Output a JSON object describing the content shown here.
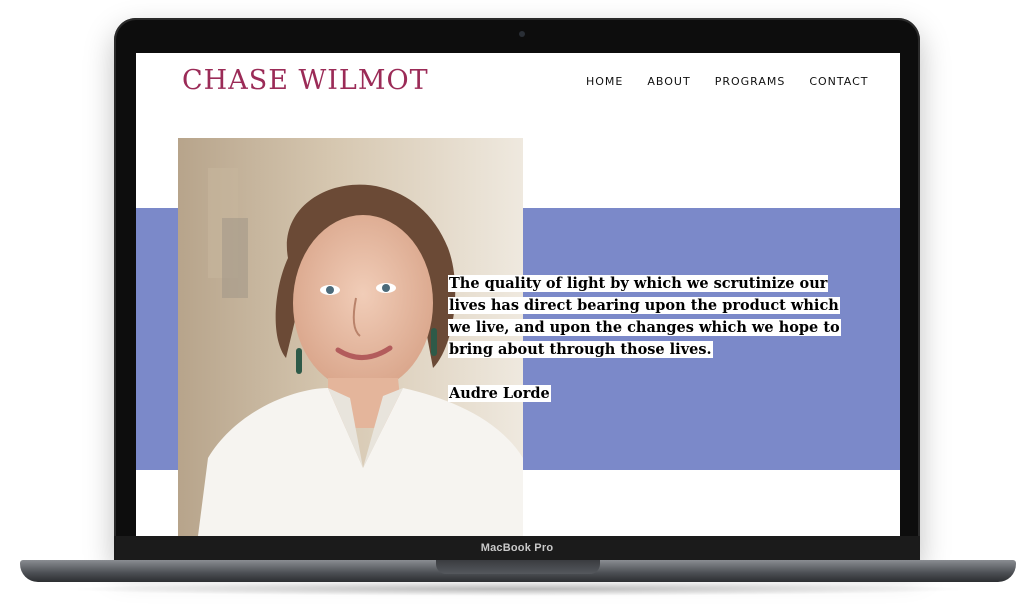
{
  "device": {
    "model_label": "MacBook Pro"
  },
  "site": {
    "brand": "CHASE WILMOT",
    "nav": [
      {
        "label": "HOME"
      },
      {
        "label": "ABOUT"
      },
      {
        "label": "PROGRAMS"
      },
      {
        "label": "CONTACT"
      }
    ],
    "quote": {
      "text": "The quality of light by which we scrutinize our lives has direct bearing upon the product which we live, and upon the changes which we hope to bring about through those lives.",
      "author": "Audre Lorde"
    }
  },
  "colors": {
    "brand": "#9b2b57",
    "band": "#7b89c9",
    "highlight": "#ffffff"
  }
}
